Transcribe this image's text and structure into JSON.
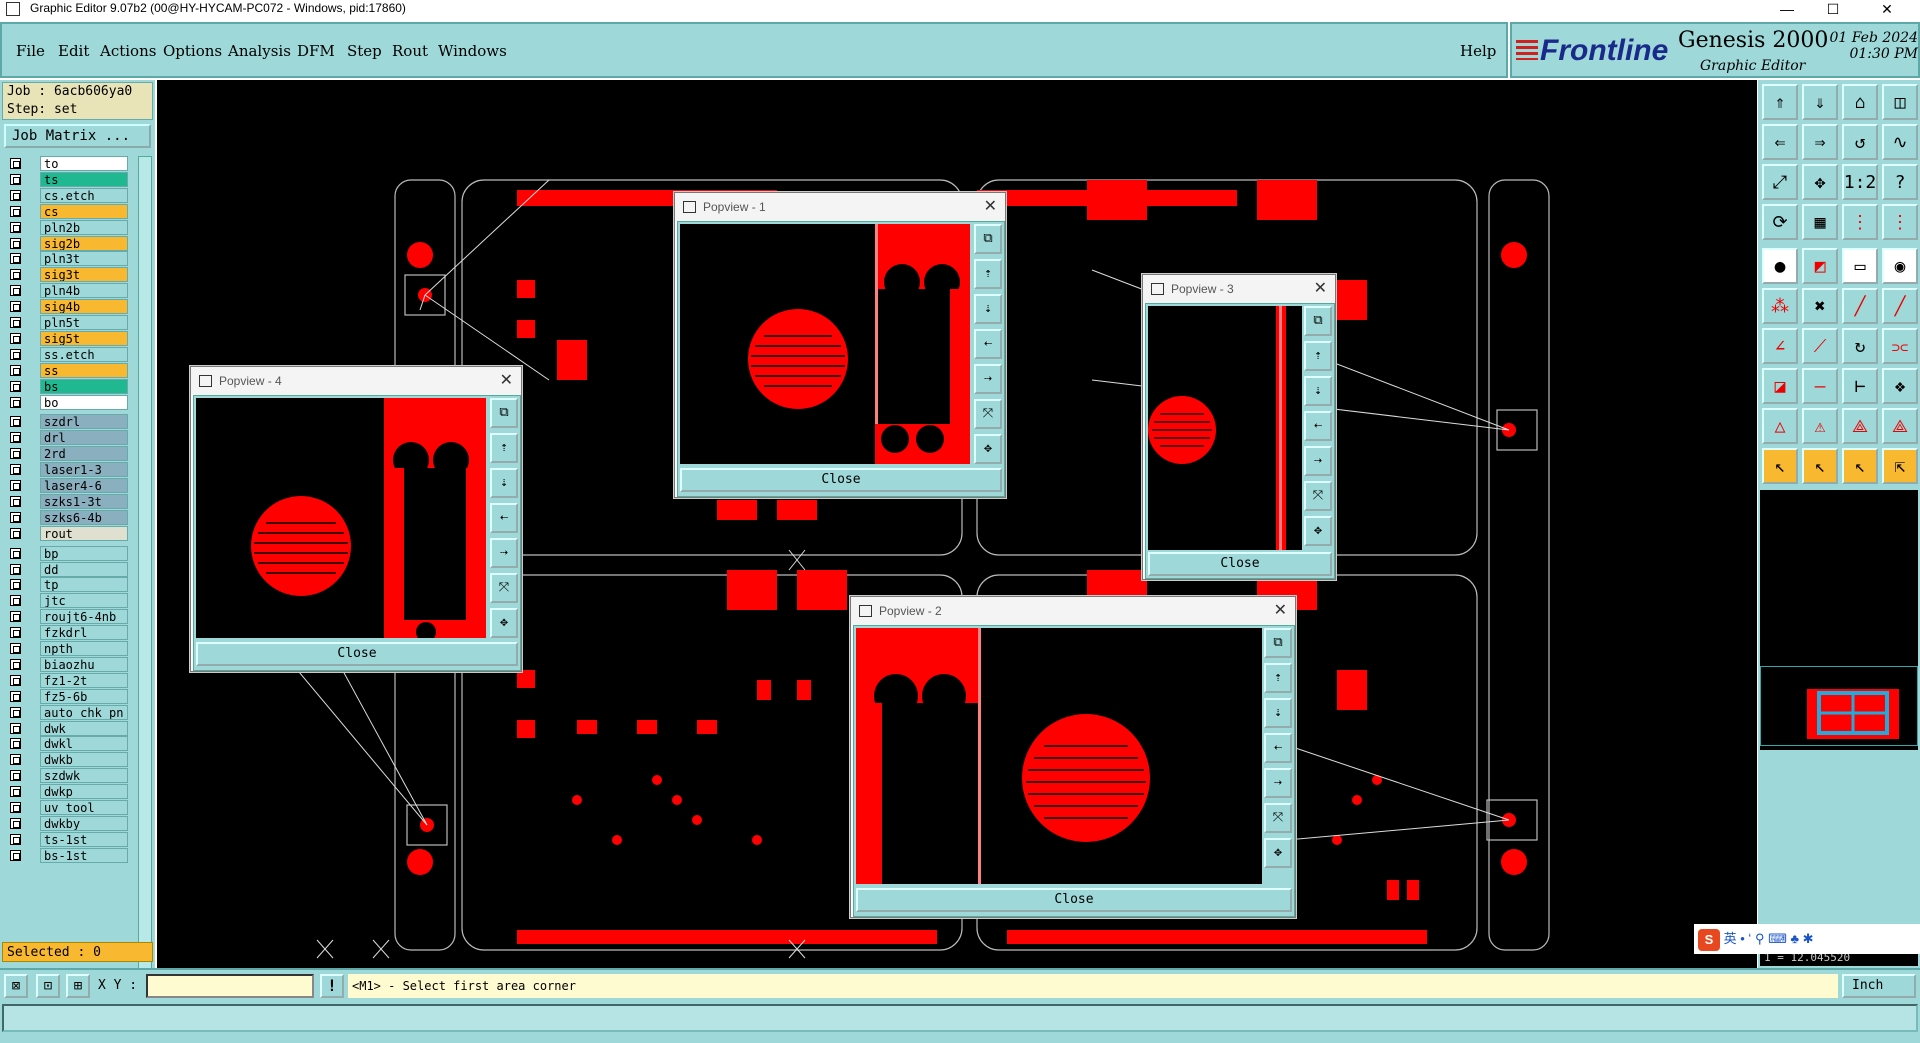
{
  "window": {
    "title": "Graphic Editor 9.07b2 (00@HY-HYCAM-PC072 - Windows, pid:17860)",
    "minimize": "—",
    "maximize": "☐",
    "close": "✕"
  },
  "menu": {
    "items": [
      "File",
      "Edit",
      "Actions",
      "Options",
      "Analysis",
      "DFM",
      "Step",
      "Rout",
      "Windows"
    ],
    "help": "Help"
  },
  "brand": {
    "logo": "Frontline",
    "product": "Genesis 2000",
    "subtitle": "Graphic Editor",
    "date": "01 Feb 2024",
    "time": "01:30 PM"
  },
  "job": {
    "job_line": "Job : 6acb606ya0",
    "step_line": "Step: set",
    "matrix_button": "Job Matrix ..."
  },
  "layers": [
    {
      "name": "to",
      "color": "#ffffff"
    },
    {
      "name": "ts",
      "color": "#20b890"
    },
    {
      "name": "cs.etch",
      "color": "#9ed8d8"
    },
    {
      "name": "cs",
      "color": "#f8b830"
    },
    {
      "name": "pln2b",
      "color": "#9ed8d8"
    },
    {
      "name": "sig2b",
      "color": "#f8b830"
    },
    {
      "name": "pln3t",
      "color": "#9ed8d8"
    },
    {
      "name": "sig3t",
      "color": "#f8b830"
    },
    {
      "name": "pln4b",
      "color": "#9ed8d8"
    },
    {
      "name": "sig4b",
      "color": "#f8b830"
    },
    {
      "name": "pln5t",
      "color": "#9ed8d8"
    },
    {
      "name": "sig5t",
      "color": "#f8b830"
    },
    {
      "name": "ss.etch",
      "color": "#9ed8d8"
    },
    {
      "name": "ss",
      "color": "#f8b830"
    },
    {
      "name": "bs",
      "color": "#20b890"
    },
    {
      "name": "bo",
      "color": "#ffffff"
    },
    {
      "name": "szdrl",
      "color": "#8ab0c0"
    },
    {
      "name": "drl",
      "color": "#8ab0c0"
    },
    {
      "name": "2rd",
      "color": "#8ab0c0"
    },
    {
      "name": "laser1-3",
      "color": "#8ab0c0"
    },
    {
      "name": "laser4-6",
      "color": "#8ab0c0"
    },
    {
      "name": "szks1-3t",
      "color": "#8ab0c0"
    },
    {
      "name": "szks6-4b",
      "color": "#8ab0c0"
    },
    {
      "name": "rout",
      "color": "#e0e0d0"
    },
    {
      "name": "bp",
      "color": "#9ed8d8"
    },
    {
      "name": "dd",
      "color": "#9ed8d8"
    },
    {
      "name": "tp",
      "color": "#9ed8d8"
    },
    {
      "name": "jtc",
      "color": "#9ed8d8"
    },
    {
      "name": "roujt6-4nb",
      "color": "#9ed8d8"
    },
    {
      "name": "fzkdrl",
      "color": "#9ed8d8"
    },
    {
      "name": "npth",
      "color": "#9ed8d8"
    },
    {
      "name": "biaozhu",
      "color": "#9ed8d8"
    },
    {
      "name": "fz1-2t",
      "color": "#9ed8d8"
    },
    {
      "name": "fz5-6b",
      "color": "#9ed8d8"
    },
    {
      "name": "auto_chk_pn",
      "color": "#9ed8d8"
    },
    {
      "name": "dwk",
      "color": "#9ed8d8"
    },
    {
      "name": "dwkl",
      "color": "#9ed8d8"
    },
    {
      "name": "dwkb",
      "color": "#9ed8d8"
    },
    {
      "name": "szdwk",
      "color": "#9ed8d8"
    },
    {
      "name": "dwkp",
      "color": "#9ed8d8"
    },
    {
      "name": "uv_tool",
      "color": "#9ed8d8"
    },
    {
      "name": "dwkby",
      "color": "#9ed8d8"
    },
    {
      "name": "ts-1st",
      "color": "#9ed8d8"
    },
    {
      "name": "bs-1st",
      "color": "#9ed8d8"
    }
  ],
  "selected": "Selected : 0",
  "popviews": [
    {
      "title": "Popview - 1",
      "close": "Close"
    },
    {
      "title": "Popview - 2",
      "close": "Close"
    },
    {
      "title": "Popview - 3",
      "close": "Close"
    },
    {
      "title": "Popview - 4",
      "close": "Close"
    }
  ],
  "statusbar": {
    "xy_label": "X Y :",
    "xy_value": "",
    "excl": "!",
    "message": "<M1> - Select first area corner",
    "unit": "Inch"
  },
  "coord_readout": "1 = 12.045520",
  "ime": {
    "s": "S",
    "lang": "英"
  },
  "colors": {
    "panel": "#9ed8d8",
    "copper": "#ff0000",
    "selected": "#f8b830"
  }
}
